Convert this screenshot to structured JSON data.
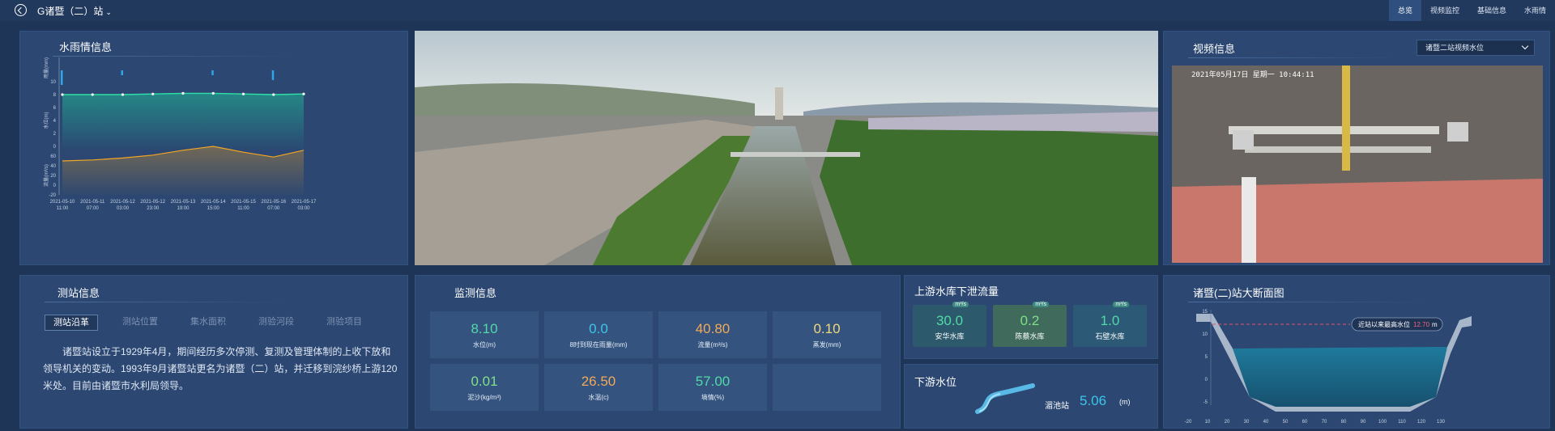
{
  "app": {
    "station_name": "G诸暨（二）站"
  },
  "nav": {
    "tabs": [
      "总览",
      "视频监控",
      "基础信息",
      "水雨情"
    ],
    "active": "总览"
  },
  "rain_panel": {
    "title": "水雨情信息",
    "axis_labels": {
      "rain": "雨量(mm)",
      "level": "水位(m)",
      "flow": "流量(m³/s)"
    },
    "x_ticks": [
      "2021-05-10 11:00",
      "2021-05-11 07:00",
      "2021-05-12 03:00",
      "2021-05-12 23:00",
      "2021-05-13 19:00",
      "2021-05-14 15:00",
      "2021-05-15 11:00",
      "2021-05-16 07:00",
      "2021-05-17 03:00"
    ],
    "level_ticks": [
      "10",
      "8",
      "6",
      "4",
      "2",
      "0"
    ],
    "flow_ticks": [
      "60",
      "40",
      "20",
      "0",
      "-20"
    ]
  },
  "chart_data": {
    "type": "line",
    "x": [
      "2021-05-10 11:00",
      "2021-05-11 07:00",
      "2021-05-12 03:00",
      "2021-05-12 23:00",
      "2021-05-13 19:00",
      "2021-05-14 15:00",
      "2021-05-15 11:00",
      "2021-05-16 07:00",
      "2021-05-17 03:00"
    ],
    "series": [
      {
        "type": "bar",
        "unit": "mm",
        "values": [
          3,
          0,
          1,
          0,
          0,
          1,
          0,
          2,
          0
        ]
      },
      {
        "type": "line",
        "unit": "m",
        "values": [
          8.0,
          8.0,
          8.0,
          8.1,
          8.2,
          8.2,
          8.1,
          8.0,
          8.1
        ]
      },
      {
        "type": "area",
        "unit": "m³/s",
        "values": [
          10,
          12,
          16,
          22,
          32,
          40,
          28,
          18,
          32
        ]
      }
    ],
    "colors": {
      "rain": "#2fa6e8",
      "level": "#2ee0a8",
      "flow": "#f5a623"
    }
  },
  "video_panel": {
    "title": "视频信息",
    "select_value": "诸暨二站视频水位",
    "overlay_time": "2021年05月17日 星期一 10:44:11"
  },
  "station_panel": {
    "title": "测站信息",
    "tabs": [
      "测站沿革",
      "测站位置",
      "集水面积",
      "测验河段",
      "测验项目"
    ],
    "active_tab": "测站沿革",
    "text": "诸暨站设立于1929年4月，期间经历多次停测、复测及管理体制的上收下放和领导机关的变动。1993年9月诸暨站更名为诸暨（二）站，并迁移到浣纱桥上游120米处。目前由诸暨市水利局领导。"
  },
  "monitor_panel": {
    "title": "监测信息",
    "items": [
      {
        "value": "8.10",
        "label": "水位(m)",
        "color": "#52d9a8"
      },
      {
        "value": "0.0",
        "label": "8时到现在雨量(mm)",
        "color": "#3cc6ea"
      },
      {
        "value": "40.80",
        "label": "流量(m³/s)",
        "color": "#f2a95a"
      },
      {
        "value": "0.10",
        "label": "蒸发(mm)",
        "color": "#f2d97a"
      },
      {
        "value": "0.01",
        "label": "泥沙(kg/m³)",
        "color": "#7ee08a"
      },
      {
        "value": "26.50",
        "label": "水温(c)",
        "color": "#f2a95a"
      },
      {
        "value": "57.00",
        "label": "墒情(%)",
        "color": "#52d9a8"
      },
      {
        "value": "",
        "label": "",
        "color": "#ffffff"
      }
    ]
  },
  "reservoir_panel": {
    "title": "上游水库下泄流量",
    "unit": "m³/s",
    "items": [
      {
        "value": "30.0",
        "label": "安华水库",
        "color": "#52d9a8"
      },
      {
        "value": "0.2",
        "label": "陈蔡水库",
        "color": "#7ee08a"
      },
      {
        "value": "1.0",
        "label": "石壁水库",
        "color": "#52d9a8"
      }
    ]
  },
  "downstream_panel": {
    "title": "下游水位",
    "station": "湄池站",
    "value": "5.06",
    "unit": "(m)"
  },
  "section_panel": {
    "title": "诸暨(二)站大断面图",
    "callout_prefix": "近站以来最高水位",
    "callout_value": "12.70",
    "callout_unit": "m",
    "x_ticks": [
      "-20",
      "10",
      "20",
      "30",
      "40",
      "50",
      "60",
      "70",
      "80",
      "90",
      "100",
      "110",
      "120",
      "130"
    ],
    "y_ticks": [
      "15",
      "10",
      "5",
      "0",
      "-5"
    ]
  }
}
